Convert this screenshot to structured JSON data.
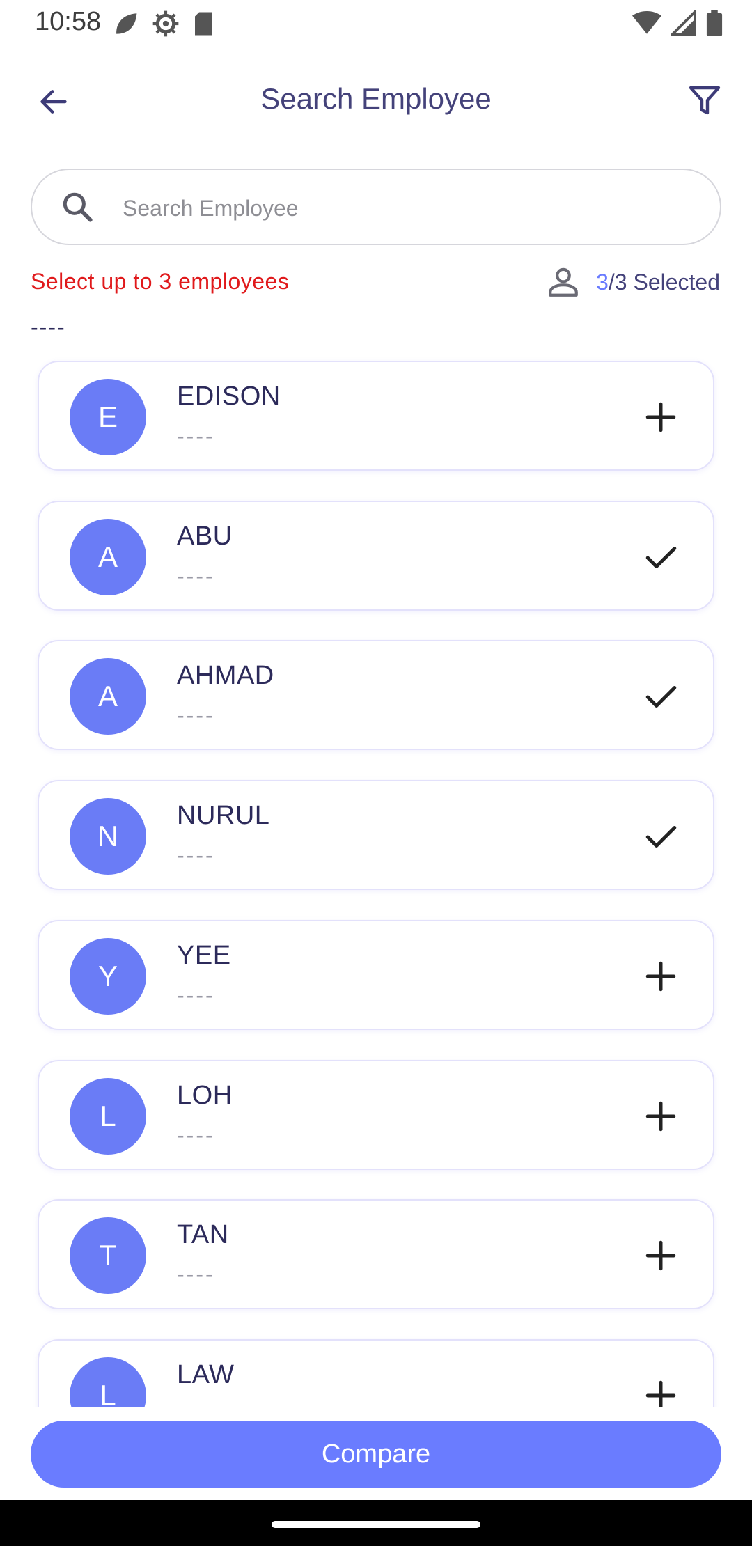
{
  "status_bar": {
    "time": "10:58",
    "left_icons": [
      "leaf-icon",
      "gear-icon",
      "sd-card-icon"
    ],
    "right_icons": [
      "wifi-icon",
      "signal-icon",
      "battery-icon"
    ]
  },
  "header": {
    "title": "Search Employee",
    "back_icon": "arrow-left-icon",
    "filter_icon": "filter-icon"
  },
  "search": {
    "placeholder": "Search Employee",
    "value": ""
  },
  "info": {
    "limit_text": "Select up to 3 employees",
    "selected_count": "3",
    "selected_rest": "/3 Selected",
    "dept_dash": "----"
  },
  "employees": [
    {
      "initial": "E",
      "name": "EDISON",
      "sub": "----",
      "selected": false
    },
    {
      "initial": "A",
      "name": "ABU",
      "sub": "----",
      "selected": true
    },
    {
      "initial": "A",
      "name": "AHMAD",
      "sub": "----",
      "selected": true
    },
    {
      "initial": "N",
      "name": "NURUL",
      "sub": "----",
      "selected": true
    },
    {
      "initial": "Y",
      "name": "YEE",
      "sub": "----",
      "selected": false
    },
    {
      "initial": "L",
      "name": "LOH",
      "sub": "----",
      "selected": false
    },
    {
      "initial": "T",
      "name": "TAN",
      "sub": "----",
      "selected": false
    },
    {
      "initial": "L",
      "name": "LAW",
      "sub": "----",
      "selected": false
    }
  ],
  "compare_label": "Compare",
  "colors": {
    "accent": "#6a7cff",
    "avatar": "#6a7cf6",
    "warning": "#e0191b",
    "title": "#44427a"
  }
}
